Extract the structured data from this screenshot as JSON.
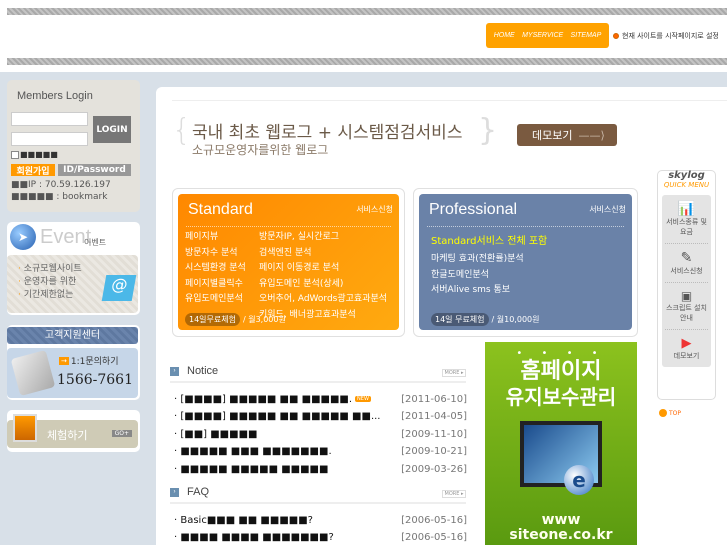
{
  "header": {
    "nav": [
      "HOME",
      "MYSERVICE",
      "SITEMAP"
    ],
    "start_page": "현재 사이트를 시작페이지로 설정"
  },
  "login": {
    "title": "Members Login",
    "login_button": "LOGIN",
    "remember": "■■■■■",
    "join": "회원가입",
    "find": "ID/Password",
    "ip": "■■IP : 70.59.126.197",
    "bookmark": "■■■■■ : bookmark"
  },
  "event": {
    "title": "Event",
    "subtitle": "이벤트",
    "items": [
      "소규모웹사이트",
      "운영자를 위한",
      "기간제한없는"
    ]
  },
  "support": {
    "title": "고객지원센터",
    "inquiry": "1:1문의하기",
    "phone": "1566-7661"
  },
  "trial": {
    "label": "체험하기",
    "go": "GO+"
  },
  "hero": {
    "title": "국내 최초 웹로그 + 시스템점검서비스",
    "subtitle": "소규모운영자를위한 웹로그",
    "demo_button": "데모보기"
  },
  "standard": {
    "title": "Standard",
    "apply": "서비스신청",
    "col1": [
      "페이지뷰",
      "방문자수 분석",
      "시스템환경 분석",
      "페이지별클릭수",
      "유입도메인분석"
    ],
    "col2": [
      "방문자IP, 실시간로그",
      "검색엔진 분석",
      "페이지 이동경로 분석",
      "유입도메인 분석(상세)",
      "오버추어, AdWords광고효과분석",
      "키워드, 배너광고효과분석"
    ],
    "trial": "14일무료체험",
    "price": "/ 월3,000원"
  },
  "professional": {
    "title": "Professional",
    "apply": "서비스신청",
    "highlight": "Standard서비스 전체 포함",
    "items": [
      "마케팅 효과(전환률)분석",
      "한글도메인분석",
      "서버Alive sms 통보"
    ],
    "trial": "14일 무료체험",
    "price": "/ 월10,000원"
  },
  "notice": {
    "title": "Notice",
    "more": "MORE ▸",
    "new_badge": "NEW",
    "items": [
      {
        "text": "· [■■■■] ■■■■■ ■■ ■■■■■.",
        "date": "[2011-06-10]",
        "new": true
      },
      {
        "text": "· [■■■■] ■■■■■ ■■ ■■■■■ ■■...",
        "date": "[2011-04-05]"
      },
      {
        "text": "· [■■] ■■■■■",
        "date": "[2009-11-10]"
      },
      {
        "text": "· ■■■■■ ■■■ ■■■■■■■.",
        "date": "[2009-10-21]"
      },
      {
        "text": "· ■■■■■ ■■■■■ ■■■■■",
        "date": "[2009-03-26]"
      }
    ]
  },
  "faq": {
    "title": "FAQ",
    "more": "MORE ▸",
    "items": [
      {
        "text": "· Basic■■■ ■■ ■■■■■?",
        "date": "[2006-05-16]"
      },
      {
        "text": "· ■■■■ ■■■■ ■■■■■■■?",
        "date": "[2006-05-16]"
      }
    ]
  },
  "banner": {
    "line1": "홈페이지",
    "line2": "유지보수관리",
    "url1": "www",
    "url2": "siteone.co.kr"
  },
  "quick": {
    "brand": "skylog",
    "title": "QUICK MENU",
    "items": [
      "서비스종류 및요금",
      "서비스신청",
      "스크립트 설치안내",
      "데모보기"
    ],
    "top": "TOP"
  }
}
